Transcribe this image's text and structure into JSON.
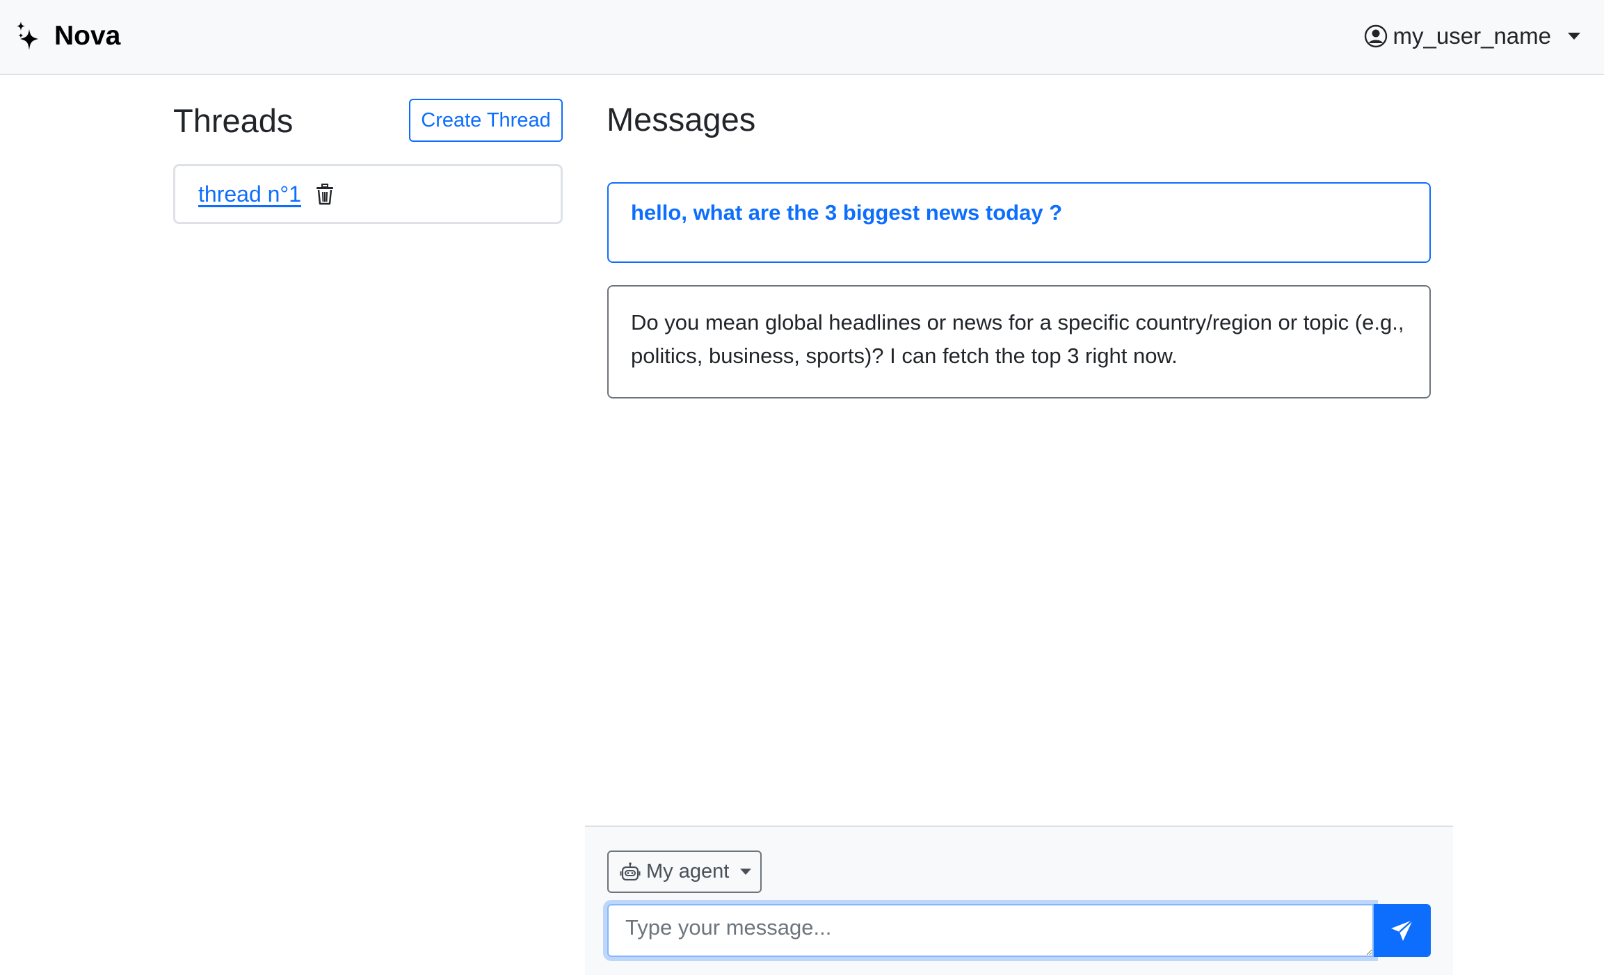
{
  "navbar": {
    "brand": "Nova",
    "brand_icon": "sparkles-icon",
    "user_name": "my_user_name",
    "user_icon": "person-circle-icon"
  },
  "threads": {
    "title": "Threads",
    "create_label": "Create Thread",
    "items": [
      {
        "label": "thread n°1",
        "action_icon": "trash-icon"
      }
    ]
  },
  "messages": {
    "title": "Messages",
    "items": [
      {
        "role": "user",
        "text": "hello, what are the 3 biggest news today ?"
      },
      {
        "role": "agent",
        "text": "Do you mean global headlines or news for a specific country/region or topic (e.g., politics, business, sports)? I can fetch the top 3 right now."
      }
    ]
  },
  "composer": {
    "agent_label": "My agent",
    "agent_icon": "robot-icon",
    "placeholder": "Type your message...",
    "value": "",
    "send_icon": "send-icon"
  },
  "colors": {
    "primary": "#0d6efd",
    "navbar_bg": "#f8f9fa",
    "border": "#dee2e6",
    "muted": "#6c757d"
  }
}
